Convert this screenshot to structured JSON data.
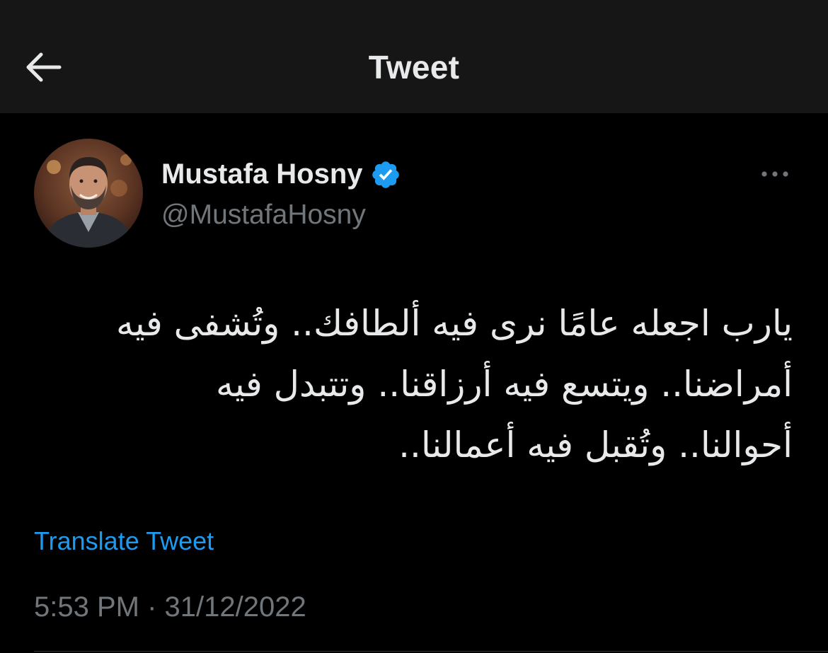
{
  "header": {
    "title": "Tweet",
    "back_icon": "arrow-left-icon"
  },
  "author": {
    "display_name": "Mustafa Hosny",
    "handle": "@MustafaHosny",
    "verified": true,
    "verified_icon": "verified-badge-icon",
    "avatar_icon": "user-avatar"
  },
  "more_icon": "more-options-icon",
  "tweet": {
    "lines": [
      "يارب اجعله عامًا نرى فيه ألطافك.. وتُشفى فيه",
      "أمراضنا.. ويتسع فيه أرزاقنا.. وتتبدل فيه",
      "أحوالنا.. وتُقبل فيه أعمالنا.."
    ]
  },
  "translate_label": "Translate Tweet",
  "meta": {
    "time": "5:53 PM",
    "separator": "·",
    "date": "31/12/2022"
  },
  "colors": {
    "background": "#000000",
    "header_background": "#161616",
    "primary_text": "#e7e9ea",
    "secondary_text": "#71767b",
    "accent": "#1d9bf0"
  }
}
